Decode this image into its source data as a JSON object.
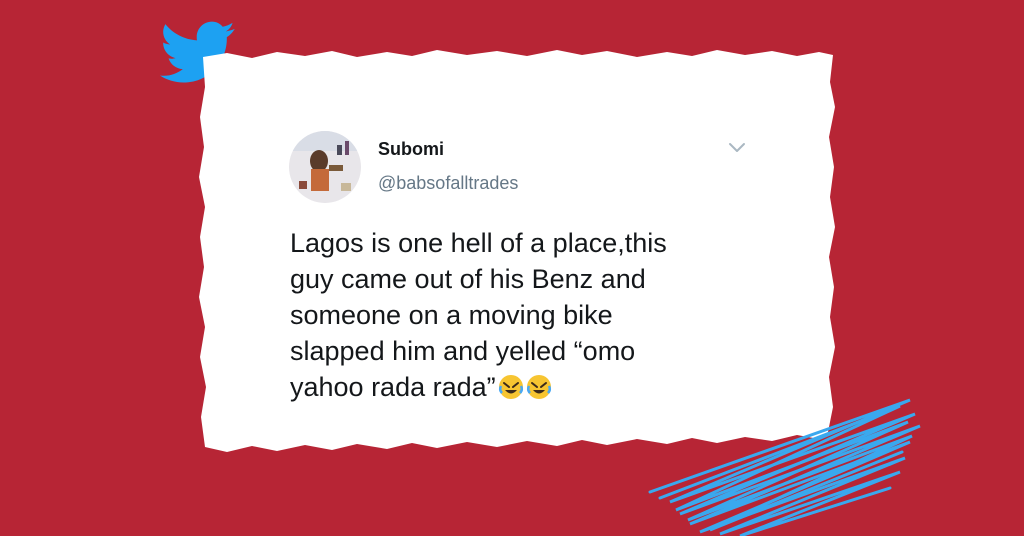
{
  "brand": {
    "icon": "twitter-bird-icon",
    "color": "#1da1f2"
  },
  "background": {
    "color": "#b72535"
  },
  "tweet": {
    "display_name": "Subomi",
    "handle": "@babsofalltrades",
    "text": "Lagos is one hell of a place,this guy came out of his Benz and someone on a moving bike slapped him and yelled “omo yahoo rada rada”",
    "emojis": [
      "rolling-on-floor-laughing-emoji",
      "rolling-on-floor-laughing-emoji"
    ],
    "menu_icon": "chevron-down-icon"
  },
  "decoration": {
    "scribble_color": "#3aa8ee"
  }
}
